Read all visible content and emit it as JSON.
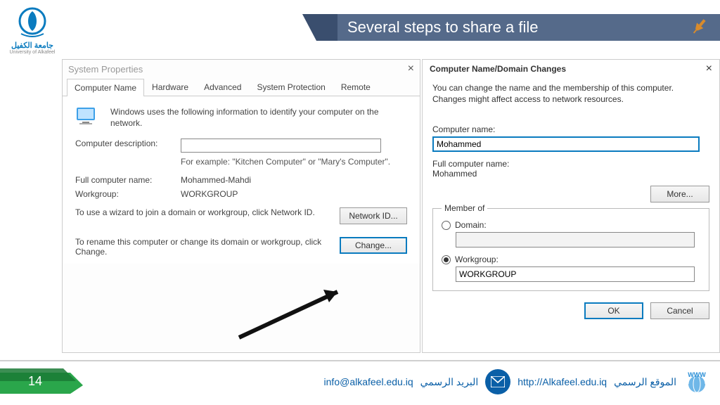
{
  "header": {
    "logo_ar": "جامعة الكفيل",
    "logo_en": "University of Alkafeel",
    "title": "Several steps to share a file"
  },
  "sp": {
    "window_title": "System Properties",
    "tabs": [
      "Computer Name",
      "Hardware",
      "Advanced",
      "System Protection",
      "Remote"
    ],
    "intro": "Windows uses the following information to identify your computer on the network.",
    "desc_label": "Computer description:",
    "example": "For example: \"Kitchen Computer\" or \"Mary's Computer\".",
    "full_label": "Full computer name:",
    "full_value": "Mohammed-Mahdi",
    "wg_label": "Workgroup:",
    "wg_value": "WORKGROUP",
    "wizard_text": "To use a wizard to join a domain or workgroup, click Network ID.",
    "netid_btn": "Network ID...",
    "change_text": "To rename this computer or change its domain or workgroup, click Change.",
    "change_btn": "Change..."
  },
  "dc": {
    "title": "Computer Name/Domain Changes",
    "intro": "You can change the name and the membership of this computer. Changes might affect access to network resources.",
    "name_label": "Computer name:",
    "name_value": "Mohammed",
    "full_label": "Full computer name:",
    "full_value": "Mohammed",
    "more_btn": "More...",
    "member_legend": "Member of",
    "domain_label": "Domain:",
    "workgroup_label": "Workgroup:",
    "workgroup_value": "WORKGROUP",
    "ok_btn": "OK",
    "cancel_btn": "Cancel"
  },
  "footer": {
    "page": "14",
    "email": "info@alkafeel.edu.iq",
    "email_ar": "البريد الرسمي",
    "site": "http://Alkafeel.edu.iq",
    "site_ar": "الموقع الرسمي"
  }
}
